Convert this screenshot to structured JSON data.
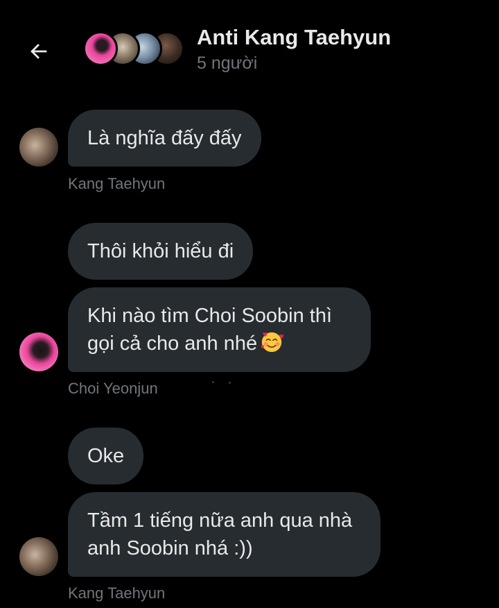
{
  "header": {
    "title": "Anti Kang Taehyun",
    "subtitle": "5 người"
  },
  "messages": [
    {
      "text": "Là nghĩa đấy đấy"
    },
    {
      "text": "Thôi khỏi hiểu đi"
    },
    {
      "line1": "Khi nào tìm Choi Soobin thì",
      "line2": "gọi cả cho anh nhé",
      "emoji": "smiling-face-with-hearts"
    },
    {
      "text": "Oke"
    },
    {
      "line1": "Tầm 1 tiếng nữa anh qua nhà",
      "line2": "anh Soobin nhá :))"
    }
  ],
  "senders": {
    "kang": "Kang Taehyun",
    "choi": "Choi Yeonjun"
  },
  "colors": {
    "background": "#000000",
    "bubble": "#272c30",
    "text": "#e7e9ea",
    "muted": "#71767b"
  }
}
